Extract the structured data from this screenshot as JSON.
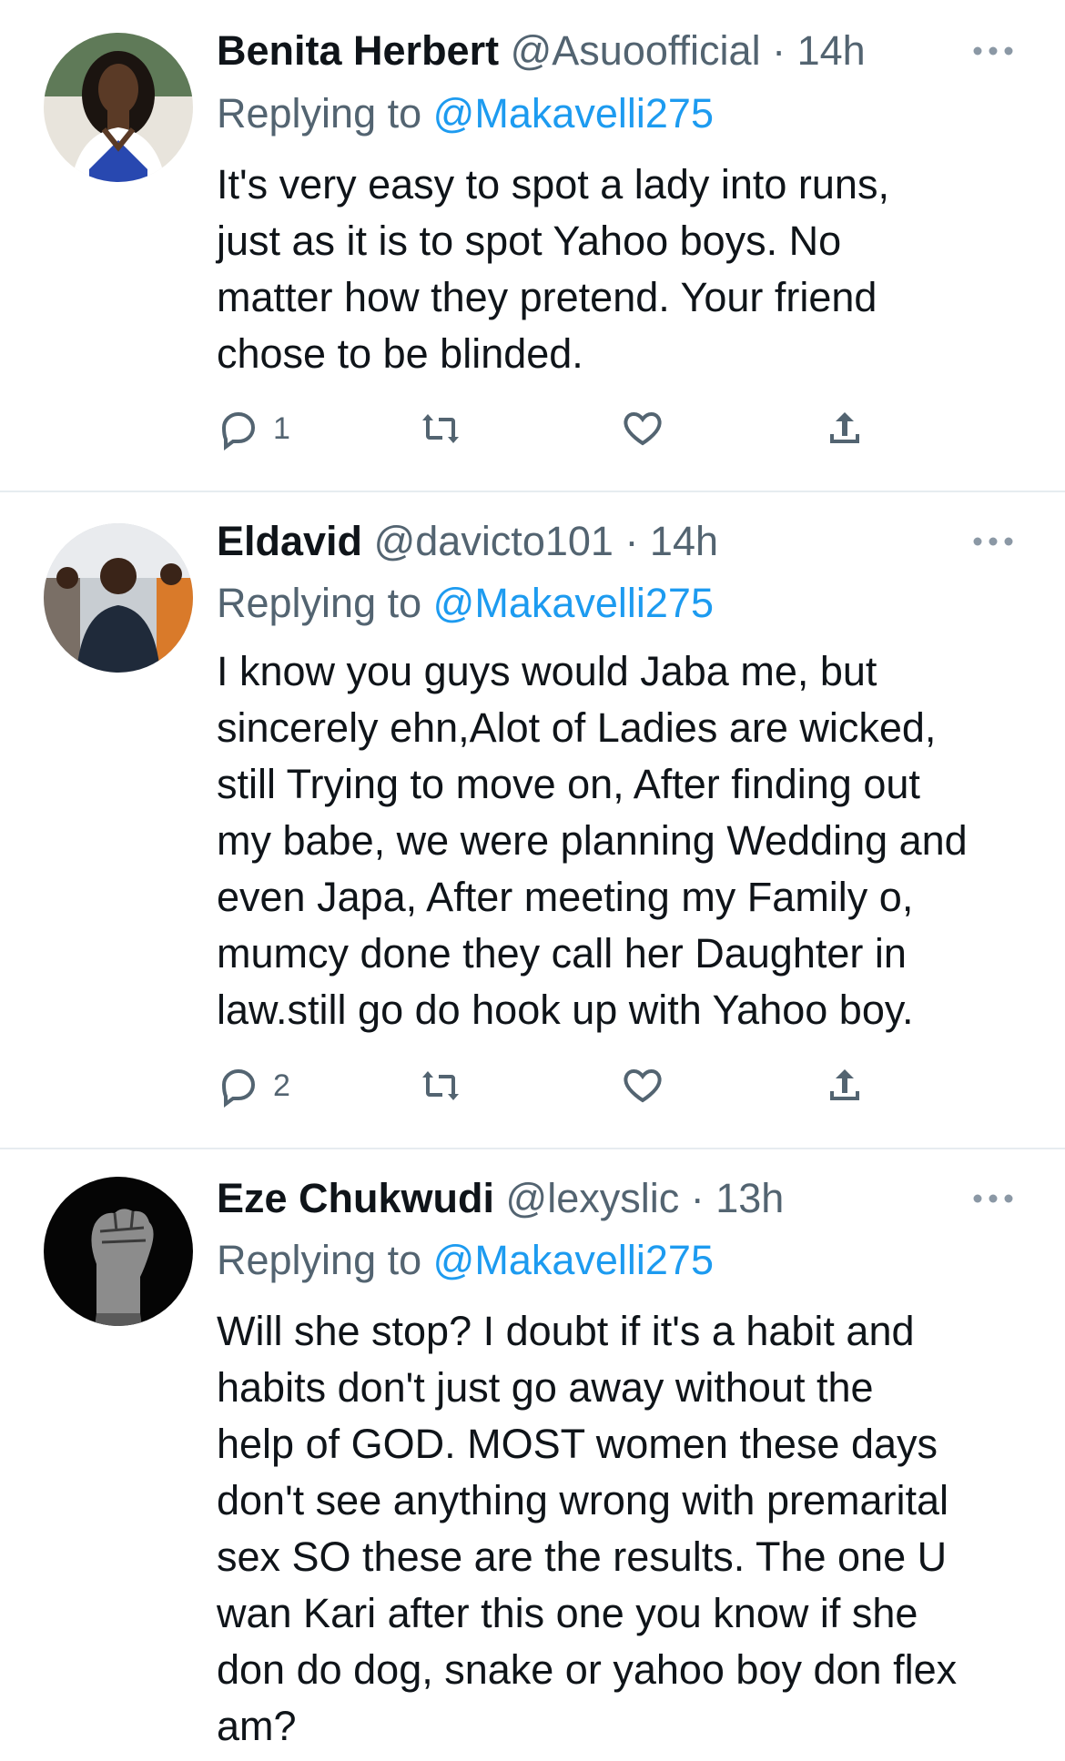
{
  "tweets": [
    {
      "name": "Benita Herbert",
      "handle": "@Asuoofficial",
      "time": "· 14h",
      "replying_prefix": "Replying to",
      "replying_handle": "@Makavelli275",
      "lines": [
        "It's very easy to spot a lady into runs,",
        "just as it is to spot Yahoo boys. No",
        "matter how they pretend. Your friend",
        "chose to be blinded."
      ],
      "reply_count": "1",
      "avatar": "woman-portrait"
    },
    {
      "name": "Eldavid",
      "handle": "@davicto101",
      "time": "· 14h",
      "replying_prefix": "Replying to",
      "replying_handle": "@Makavelli275",
      "lines": [
        "I know you guys would Jaba me,  but",
        "sincerely ehn,Alot of Ladies are wicked,",
        "still Trying to move on, After finding out",
        "my babe, we were planning  Wedding and",
        "even Japa, After meeting my Family o,",
        "mumcy done they call her Daughter in",
        "law.still go do hook up with Yahoo boy."
      ],
      "reply_count": "2",
      "avatar": "man-in-group-photo"
    },
    {
      "name": "Eze Chukwudi",
      "handle": "@lexyslic",
      "time": "· 13h",
      "replying_prefix": "Replying to",
      "replying_handle": "@Makavelli275",
      "lines": [
        "Will she stop? I doubt if it's a habit and",
        "habits don't just go away without the",
        "help of GOD. MOST women these days",
        "don't see anything wrong with premarital",
        "sex SO these are the results. The one U",
        "wan Kari after this one you know if she",
        "don do dog, snake or yahoo boy don flex",
        "am?"
      ],
      "reply_count": "",
      "avatar": "raised-fist"
    }
  ],
  "colors": {
    "text": "#0f1419",
    "secondary": "#536471",
    "link": "#1d9bf0",
    "divider": "#e6ecf0"
  }
}
